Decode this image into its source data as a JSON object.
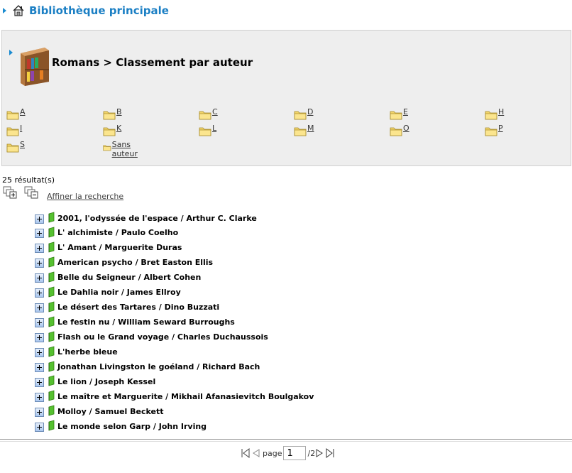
{
  "header": {
    "title": "Bibliothèque principale"
  },
  "panel": {
    "title": "Romans > Classement par auteur"
  },
  "folders": [
    "A",
    "B",
    "C",
    "D",
    "E",
    "H",
    "I",
    "K",
    "L",
    "M",
    "O",
    "P",
    "S",
    "Sans auteur"
  ],
  "results_count": "25 résultat(s)",
  "refine_label": "Affiner la recherche",
  "results": [
    "2001, l'odyssée de l'espace / Arthur C. Clarke",
    "L' alchimiste / Paulo Coelho",
    "L' Amant / Marguerite Duras",
    "American psycho / Bret Easton Ellis",
    "Belle du Seigneur / Albert Cohen",
    "Le Dahlia noir / James Ellroy",
    "Le désert des Tartares / Dino Buzzati",
    "Le festin nu / William Seward Burroughs",
    "Flash ou le Grand voyage / Charles Duchaussois",
    "L'herbe bleue",
    "Jonathan Livingston le goéland / Richard Bach",
    "Le lion / Joseph Kessel",
    "Le maître et Marguerite / Mikhail Afanasievitch Boulgakov",
    "Molloy / Samuel Beckett",
    "Le monde selon Garp / John Irving"
  ],
  "pager": {
    "page_label": "page",
    "current": "1",
    "total": "/2"
  },
  "icons": {
    "home": "home-icon",
    "shelf": "bookshelf-icon",
    "folder": "folder-icon",
    "book": "book-icon"
  }
}
